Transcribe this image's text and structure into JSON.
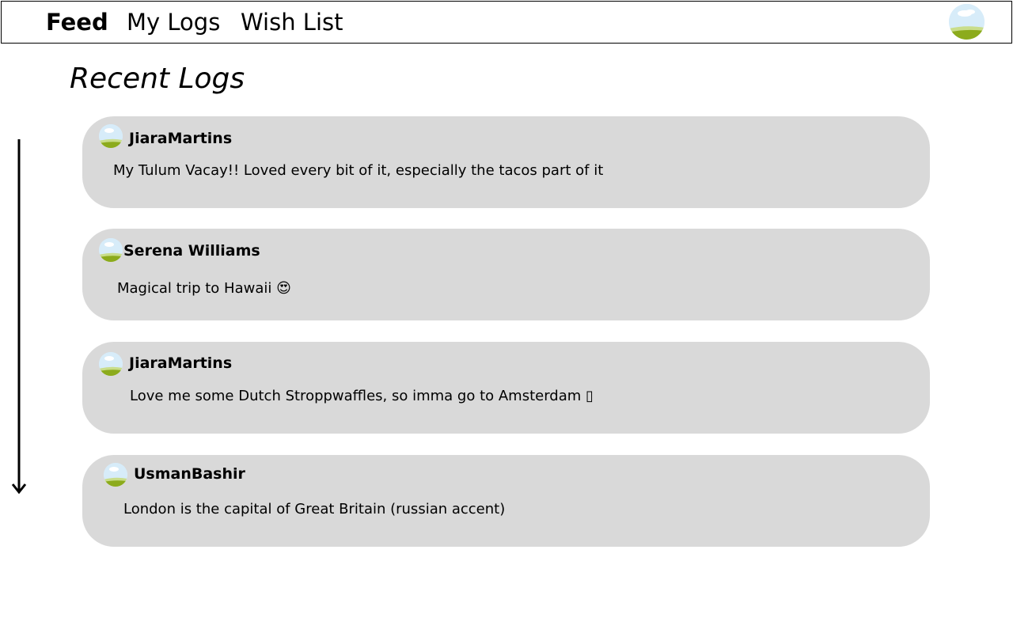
{
  "nav": {
    "feed": "Feed",
    "my_logs": "My Logs",
    "wish_list": "Wish List"
  },
  "section": {
    "title": "Recent Logs"
  },
  "posts": [
    {
      "username": "JiaraMartins",
      "text": "My Tulum Vacay!! Loved every bit of it, especially the tacos part of it"
    },
    {
      "username": "Serena Williams",
      "text": "Magical trip to Hawaii 😍"
    },
    {
      "username": "JiaraMartins",
      "text": "Love me some Dutch Stroppwaffles, so imma go to Amsterdam ▯"
    },
    {
      "username": "UsmanBashir",
      "text": "London is the capital of Great Britain (russian accent)"
    }
  ],
  "icons": {
    "profile": "profile-avatar-icon",
    "scroll": "down-arrow-icon"
  }
}
